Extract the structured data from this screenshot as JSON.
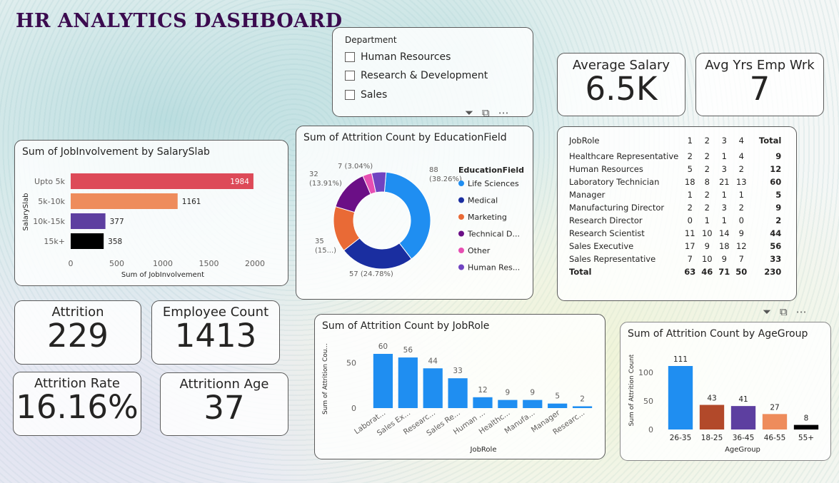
{
  "title": "HR ANALYTICS DASHBOARD",
  "slicer": {
    "header": "Department",
    "options": [
      "Human Resources",
      "Research & Development",
      "Sales"
    ]
  },
  "visual_icons": {
    "filter": "filter-icon",
    "focus": "focus-mode-icon",
    "more": "more-options-icon"
  },
  "kpis": {
    "avg_salary": {
      "label": "Average Salary",
      "value": "6.5K"
    },
    "avg_yrs": {
      "label": "Avg Yrs Emp Wrk",
      "value": "7"
    },
    "attrition": {
      "label": "Attrition",
      "value": "229"
    },
    "employee_count": {
      "label": "Employee Count",
      "value": "1413"
    },
    "attrition_rate": {
      "label": "Attrition Rate",
      "value": "16.16%"
    },
    "attrition_age": {
      "label": "Attritionn Age",
      "value": "37"
    }
  },
  "matrix": {
    "headers": [
      "JobRole",
      "1",
      "2",
      "3",
      "4",
      "Total"
    ],
    "rows": [
      [
        "Healthcare Representative",
        "2",
        "2",
        "1",
        "4",
        "9"
      ],
      [
        "Human Resources",
        "5",
        "2",
        "3",
        "2",
        "12"
      ],
      [
        "Laboratory Technician",
        "18",
        "8",
        "21",
        "13",
        "60"
      ],
      [
        "Manager",
        "1",
        "2",
        "1",
        "1",
        "5"
      ],
      [
        "Manufacturing Director",
        "2",
        "2",
        "3",
        "2",
        "9"
      ],
      [
        "Research Director",
        "0",
        "1",
        "1",
        "0",
        "2"
      ],
      [
        "Research Scientist",
        "11",
        "10",
        "14",
        "9",
        "44"
      ],
      [
        "Sales Executive",
        "17",
        "9",
        "18",
        "12",
        "56"
      ],
      [
        "Sales Representative",
        "7",
        "10",
        "9",
        "7",
        "33"
      ]
    ],
    "total": [
      "Total",
      "63",
      "46",
      "71",
      "50",
      "230"
    ]
  },
  "chart_data": [
    {
      "id": "salaryslab",
      "type": "bar",
      "orientation": "horizontal",
      "title": "Sum of JobInvolvement by SalarySlab",
      "xlabel": "Sum of JobInvolvement",
      "ylabel": "SalarySlab",
      "categories": [
        "Upto 5k",
        "5k-10k",
        "10k-15k",
        "15k+"
      ],
      "values": [
        1984,
        1161,
        377,
        358
      ],
      "colors": [
        "#dd4a58",
        "#ee8c5c",
        "#5d3fa0",
        "#000000"
      ],
      "xlim": [
        0,
        2000
      ],
      "xticks": [
        "0",
        "500",
        "1000",
        "1500",
        "2000"
      ],
      "data_labels": [
        "1984",
        "1161",
        "377",
        "358"
      ]
    },
    {
      "id": "education",
      "type": "pie",
      "donut": true,
      "title": "Sum of Attrition Count by EducationField",
      "legend_title": "EducationField",
      "legend_position": "right",
      "categories": [
        "Life Sciences",
        "Medical",
        "Marketing",
        "Technical D...",
        "Other",
        "Human Res..."
      ],
      "values": [
        88,
        57,
        35,
        32,
        7,
        11
      ],
      "colors": [
        "#1f8ef1",
        "#1a2ea0",
        "#e96a36",
        "#6b0f86",
        "#e64fb2",
        "#7043c1"
      ],
      "data_labels": [
        "88\n(38.26%)",
        "57 (24.78%)",
        "35\n(15...)",
        "32\n(13.91%)",
        "7 (3.04%)",
        ""
      ]
    },
    {
      "id": "jobrole",
      "type": "bar",
      "title": "Sum of Attrition Count by JobRole",
      "xlabel": "JobRole",
      "ylabel": "Sum of Attrition Cou...",
      "categories": [
        "Laborat...",
        "Sales Ex...",
        "Researc...",
        "Sales Re...",
        "Human ...",
        "Healthc...",
        "Manufa...",
        "Manager",
        "Researc..."
      ],
      "values": [
        60,
        56,
        44,
        33,
        12,
        9,
        9,
        5,
        2
      ],
      "color": "#1f8ef1",
      "ylim": [
        0,
        60
      ],
      "yticks": [
        "0",
        "50"
      ]
    },
    {
      "id": "agegroup",
      "type": "bar",
      "title": "Sum of Attrition Count by AgeGroup",
      "xlabel": "AgeGroup",
      "ylabel": "Sum of Attrition Count",
      "categories": [
        "26-35",
        "18-25",
        "36-45",
        "46-55",
        "55+"
      ],
      "values": [
        111,
        43,
        41,
        27,
        8
      ],
      "colors": [
        "#1f8ef1",
        "#b2492a",
        "#5d3fa0",
        "#ee8c5c",
        "#000000"
      ],
      "ylim": [
        0,
        111
      ],
      "yticks": [
        "0",
        "50",
        "100"
      ]
    }
  ]
}
